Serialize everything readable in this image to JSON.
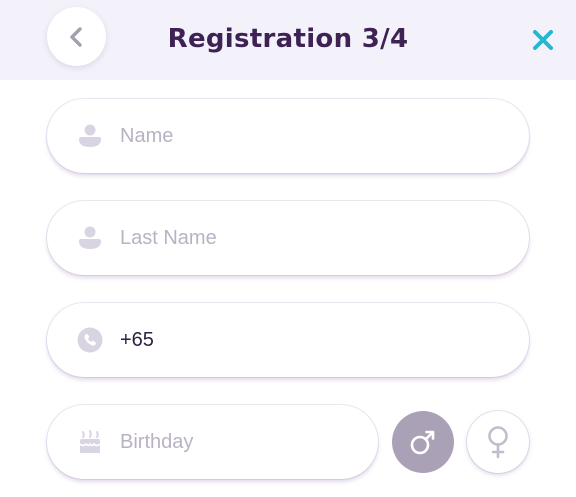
{
  "header": {
    "title": "Registration 3/4",
    "back_icon": "chevron-left-icon",
    "close_icon": "close-icon",
    "close_color": "#22b8cf"
  },
  "form": {
    "name": {
      "placeholder": "Name",
      "icon": "user-icon"
    },
    "last_name": {
      "placeholder": "Last Name",
      "icon": "user-icon"
    },
    "phone": {
      "value": "+65",
      "icon": "phone-icon"
    },
    "birthday": {
      "placeholder": "Birthday",
      "icon": "cake-icon"
    }
  },
  "gender": {
    "male": {
      "icon": "male-icon",
      "selected": true
    },
    "female": {
      "icon": "female-icon",
      "selected": false
    }
  },
  "colors": {
    "title": "#3d2253",
    "header_bg": "#f3f1fa",
    "placeholder": "#b9b2c4",
    "icon": "#d9d4e2",
    "selected": "#aba1b6"
  }
}
